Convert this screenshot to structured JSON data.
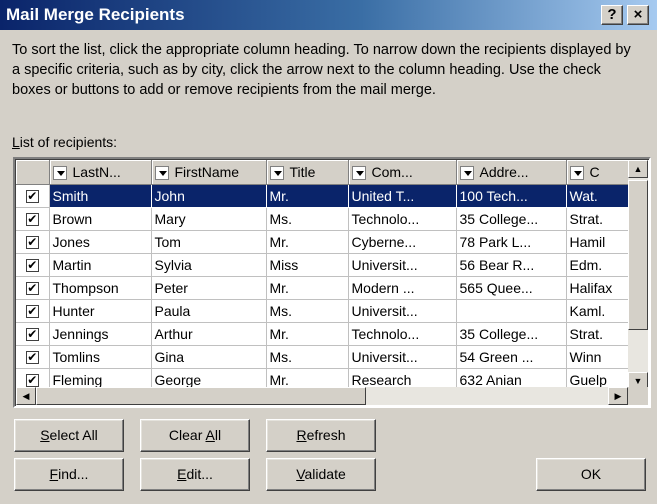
{
  "window": {
    "title": "Mail Merge Recipients",
    "help_label": "?",
    "close_label": "×"
  },
  "instructions": "To sort the list, click the appropriate column heading.  To narrow down the recipients displayed by a specific criteria, such as by city, click the arrow next to the column heading.  Use the check boxes or buttons to add or remove recipients from the mail merge.",
  "list_label": {
    "hotkey": "L",
    "rest": "ist of recipients:"
  },
  "columns": [
    "LastN...",
    "FirstName",
    "Title",
    "Com...",
    "Addre...",
    "C"
  ],
  "rows": [
    {
      "checked": true,
      "selected": true,
      "cells": [
        "Smith",
        "John",
        "Mr.",
        "United T...",
        "100 Tech...",
        "Wat."
      ]
    },
    {
      "checked": true,
      "selected": false,
      "cells": [
        "Brown",
        "Mary",
        "Ms.",
        "Technolo...",
        "35 College...",
        "Strat."
      ]
    },
    {
      "checked": true,
      "selected": false,
      "cells": [
        "Jones",
        "Tom",
        "Mr.",
        "Cyberne...",
        "78 Park L...",
        "Hamil"
      ]
    },
    {
      "checked": true,
      "selected": false,
      "cells": [
        "Martin",
        "Sylvia",
        "Miss",
        "Universit...",
        "56 Bear R...",
        "Edm."
      ]
    },
    {
      "checked": true,
      "selected": false,
      "cells": [
        "Thompson",
        "Peter",
        "Mr.",
        "Modern ...",
        "565 Quee...",
        "Halifax"
      ]
    },
    {
      "checked": true,
      "selected": false,
      "cells": [
        "Hunter",
        "Paula",
        "Ms.",
        "Universit...",
        "",
        "Kaml."
      ]
    },
    {
      "checked": true,
      "selected": false,
      "cells": [
        "Jennings",
        "Arthur",
        "Mr.",
        "Technolo...",
        "35 College...",
        "Strat."
      ]
    },
    {
      "checked": true,
      "selected": false,
      "cells": [
        "Tomlins",
        "Gina",
        "Ms.",
        "Universit...",
        "54 Green ...",
        "Winn"
      ]
    },
    {
      "checked": true,
      "selected": false,
      "cells": [
        "Fleming",
        "George",
        "Mr.",
        "Research",
        "632 Anian",
        "Guelp"
      ]
    }
  ],
  "buttons": {
    "select_all": {
      "hotkey": "S",
      "rest": "elect All"
    },
    "clear_all": {
      "pre": "Clear ",
      "hotkey": "A",
      "rest": "ll"
    },
    "refresh": {
      "hotkey": "R",
      "rest": "efresh"
    },
    "find": {
      "hotkey": "F",
      "rest": "ind..."
    },
    "edit": {
      "hotkey": "E",
      "rest": "dit..."
    },
    "validate": {
      "hotkey": "V",
      "rest": "alidate"
    },
    "ok": "OK"
  },
  "colors": {
    "title_start": "#0a246a",
    "title_end": "#a6caf0",
    "selection": "#0a246a",
    "dialog_bg": "#d4d0c8"
  },
  "icons": {
    "check": "✔",
    "scroll_up": "▲",
    "scroll_down": "▼",
    "scroll_left": "◀",
    "scroll_right": "▶",
    "dropdown": "chevron-down"
  }
}
